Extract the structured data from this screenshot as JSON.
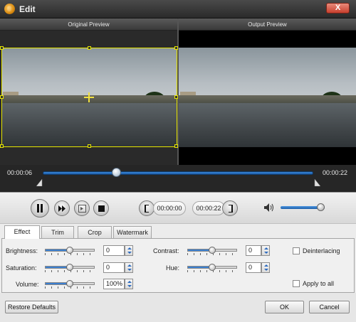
{
  "window": {
    "title": "Edit",
    "close_label": "X"
  },
  "preview": {
    "original_label": "Original Preview",
    "output_label": "Output Preview"
  },
  "timeline": {
    "current_time": "00:00:06",
    "total_time": "00:00:22",
    "progress_fraction": 0.27
  },
  "playback": {
    "start_time": "00:00:00",
    "end_time": "00:00:22",
    "volume_fraction": 0.9
  },
  "tabs": [
    {
      "label": "Effect",
      "active": true
    },
    {
      "label": "Trim",
      "active": false
    },
    {
      "label": "Crop",
      "active": false
    },
    {
      "label": "Watermark",
      "active": false
    }
  ],
  "effect": {
    "brightness": {
      "label": "Brightness:",
      "value": "0",
      "level": 0.5
    },
    "saturation": {
      "label": "Saturation:",
      "value": "0",
      "level": 0.5
    },
    "volume": {
      "label": "Volume:",
      "value": "100%",
      "level": 0.5
    },
    "contrast": {
      "label": "Contrast:",
      "value": "0",
      "level": 0.5
    },
    "hue": {
      "label": "Hue:",
      "value": "0",
      "level": 0.5
    },
    "deinterlacing": {
      "label": "Deinterlacing",
      "checked": false
    },
    "apply_to_all": {
      "label": "Apply to all",
      "checked": false
    }
  },
  "footer": {
    "restore_label": "Restore Defaults",
    "ok_label": "OK",
    "cancel_label": "Cancel"
  },
  "colors": {
    "accent": "#2d6bbf",
    "crop_frame": "#e6e600",
    "close_red": "#c8402e"
  }
}
